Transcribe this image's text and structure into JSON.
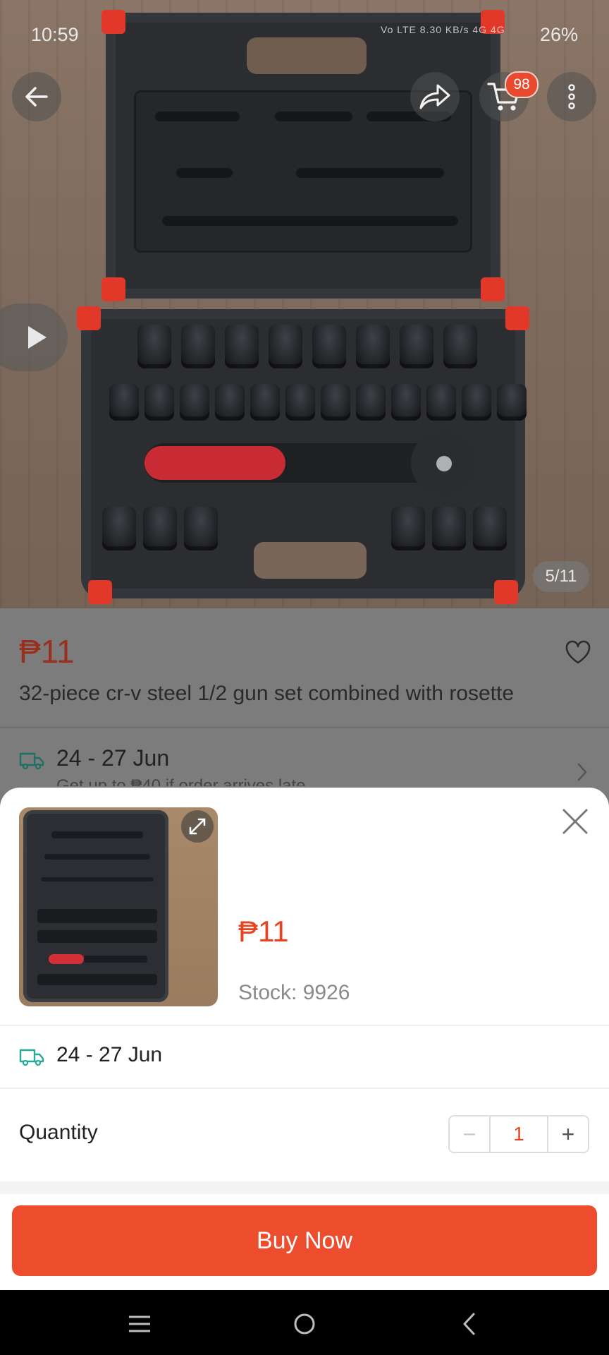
{
  "status_bar": {
    "time": "10:59",
    "signal": "Vo LTE  8.30 KB/s  4G  4G",
    "battery": "26%"
  },
  "gallery": {
    "page_indicator": "5/11",
    "cart_badge": "98"
  },
  "product": {
    "price": "₱11",
    "title": "32-piece cr-v steel 1/2 gun set combined with rosette",
    "delivery": "24 - 27 Jun",
    "delivery_note": "Get up to ₱40 if order arrives late"
  },
  "sheet": {
    "price": "₱11",
    "stock": "Stock: 9926",
    "delivery": "24 - 27 Jun",
    "quantity_label": "Quantity",
    "quantity_minus": "−",
    "quantity_value": "1",
    "quantity_plus": "+",
    "buy_label": "Buy Now"
  },
  "colors": {
    "accent": "#ee4d2d",
    "delivery_icon": "#26aa99"
  },
  "icons": [
    "back-arrow-icon",
    "share-icon",
    "cart-icon",
    "more-vertical-icon",
    "play-icon",
    "heart-icon",
    "truck-icon",
    "chevron-right-icon",
    "expand-icon",
    "close-icon",
    "menu-icon",
    "home-icon",
    "back-icon"
  ]
}
